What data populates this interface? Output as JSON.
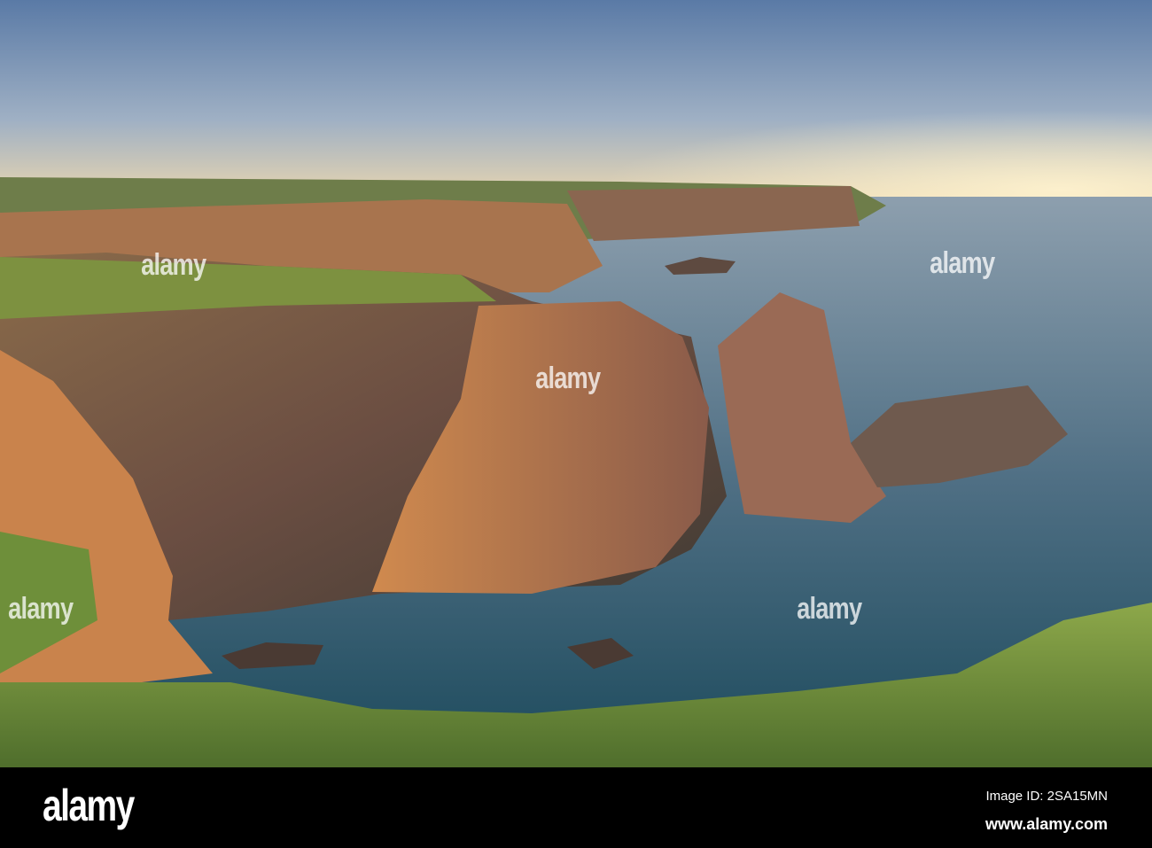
{
  "watermark": "alamy",
  "footer": {
    "logo": "alamy",
    "image_id": "Image ID: 2SA15MN",
    "url": "www.alamy.com"
  }
}
